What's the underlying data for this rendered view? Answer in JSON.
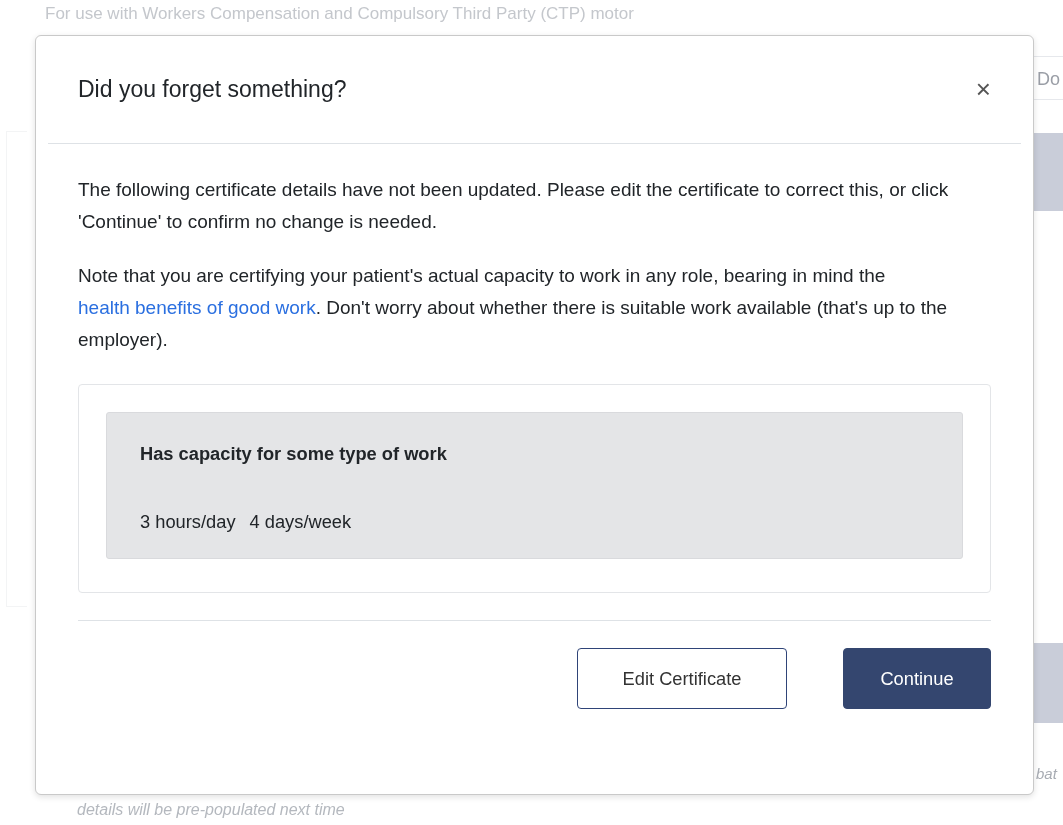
{
  "background": {
    "intro_text": "For use with Workers Compensation and Compulsory Third Party (CTP) motor",
    "field_text": "Do",
    "side_text": "bat",
    "footer_note": "details will be pre-populated next time"
  },
  "dialog": {
    "title": "Did you forget something?",
    "close": "×",
    "paragraphs": [
      "The following certificate details have not been updated. Please edit the certificate to correct this, or click 'Continue' to confirm no change is needed."
    ],
    "note": {
      "before": "Note that you are certifying your patient's actual capacity to work in any role, bearing in mind the ",
      "link": "health benefits of good work",
      "after": ". Don't worry about whether there is suitable work available (that's up to the employer)."
    },
    "summary": {
      "heading": "Has capacity for some type of work",
      "details": [
        "3 hours/day",
        "4 days/week"
      ]
    },
    "buttons": [
      {
        "label": "Edit Certificate",
        "kind": "secondary"
      },
      {
        "label": "Continue",
        "kind": "primary"
      }
    ]
  }
}
